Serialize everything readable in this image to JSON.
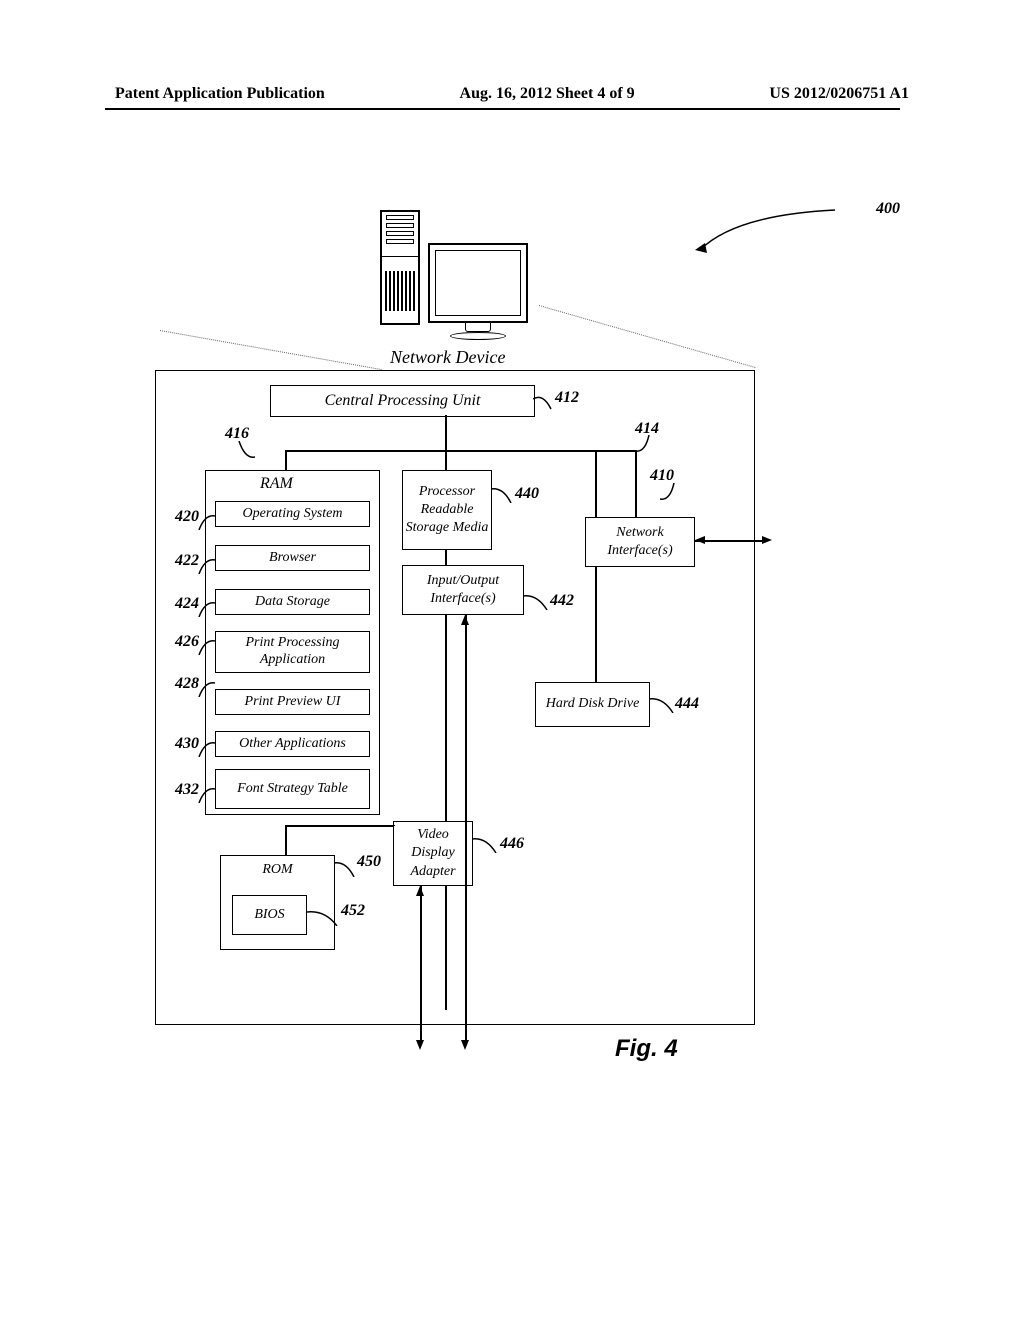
{
  "header": {
    "left": "Patent Application Publication",
    "center": "Aug. 16, 2012  Sheet 4 of 9",
    "right": "US 2012/0206751 A1"
  },
  "diagram": {
    "top_label": "Network Device",
    "cpu": "Central Processing Unit",
    "ram_label": "RAM",
    "ram_items": {
      "os": "Operating System",
      "browser": "Browser",
      "data_storage": "Data Storage",
      "print_proc": "Print Processing Application",
      "print_preview": "Print Preview UI",
      "other_apps": "Other Applications",
      "font_strategy": "Font Strategy Table"
    },
    "prsm": "Processor Readable Storage Media",
    "io": "Input/Output Interface(s)",
    "net_if": "Network Interface(s)",
    "hdd": "Hard Disk Drive",
    "vda": "Video Display Adapter",
    "rom": "ROM",
    "bios": "BIOS",
    "refs": {
      "r400": "400",
      "r412": "412",
      "r414": "414",
      "r416": "416",
      "r410": "410",
      "r420": "420",
      "r422": "422",
      "r424": "424",
      "r426": "426",
      "r428": "428",
      "r430": "430",
      "r432": "432",
      "r440": "440",
      "r442": "442",
      "r444": "444",
      "r446": "446",
      "r450": "450",
      "r452": "452"
    },
    "fig_label": "Fig. 4"
  }
}
